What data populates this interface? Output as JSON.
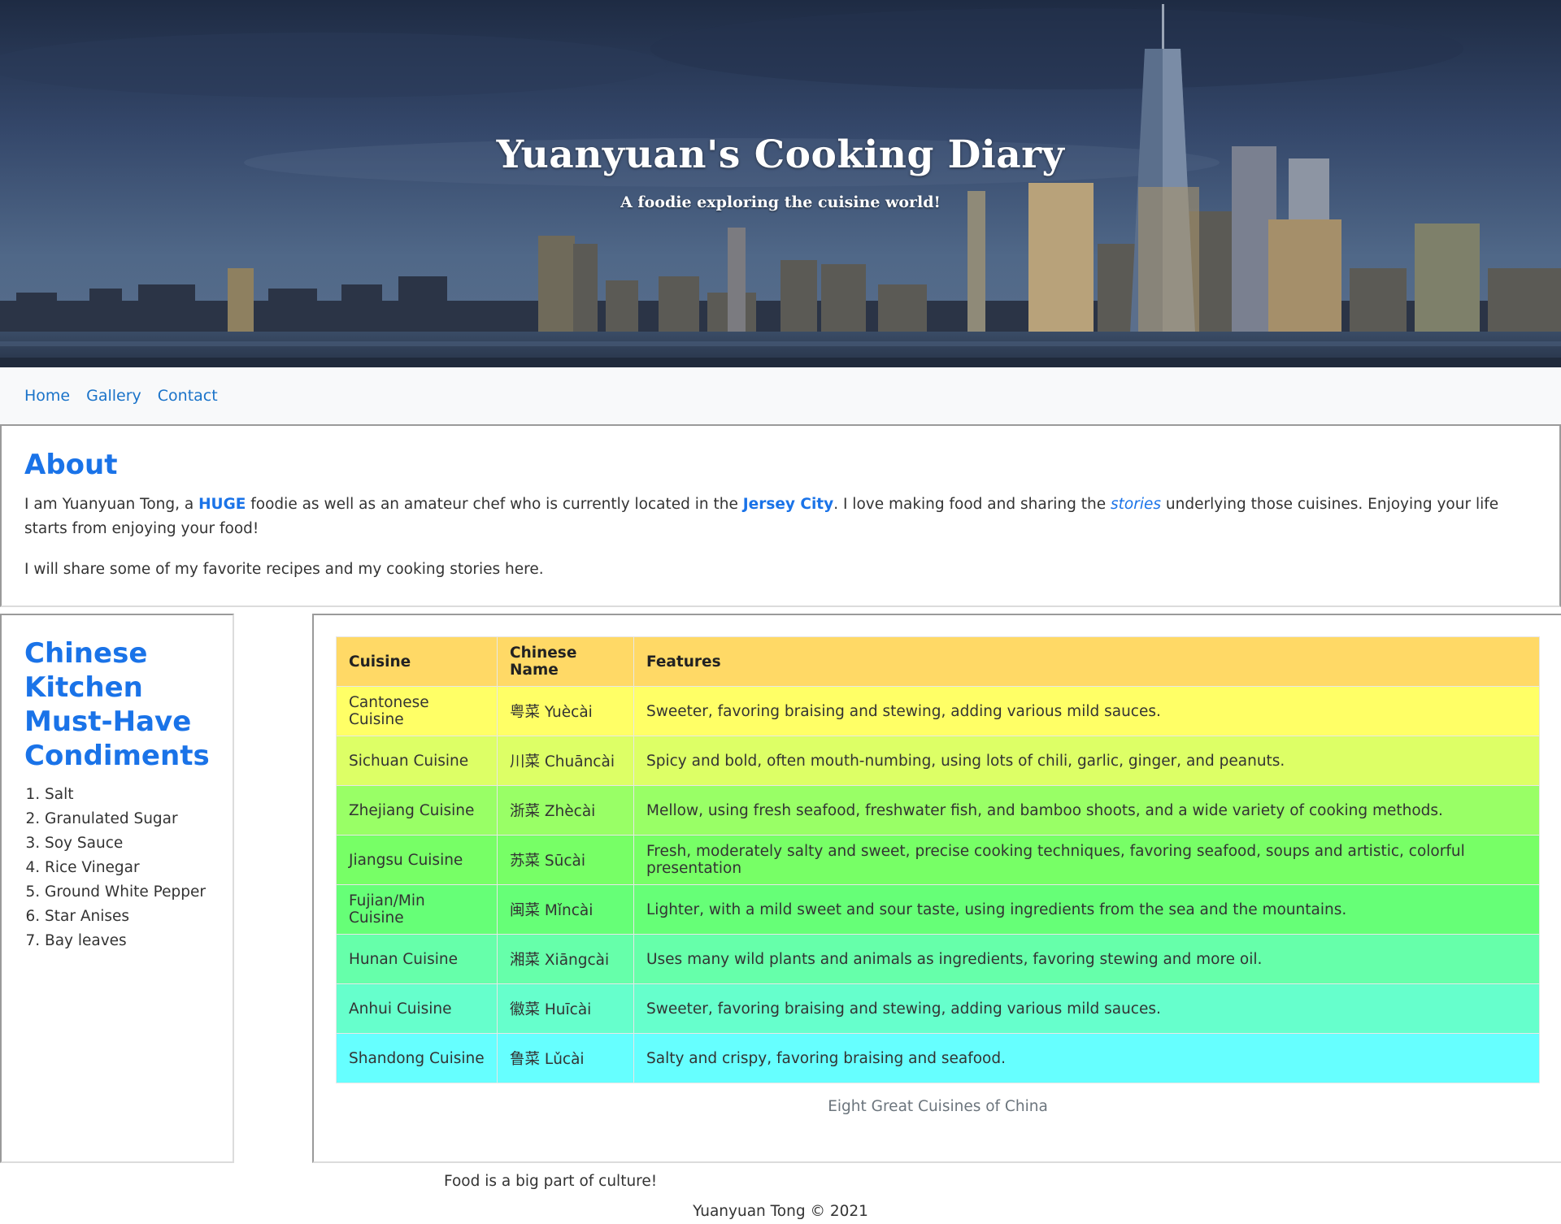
{
  "header": {
    "title": "Yuanyuan's Cooking Diary",
    "subtitle": "A foodie exploring the cuisine world!"
  },
  "nav": {
    "items": [
      {
        "label": "Home"
      },
      {
        "label": "Gallery"
      },
      {
        "label": "Contact"
      }
    ]
  },
  "about": {
    "heading": "About",
    "p1_a": "I am Yuanyuan Tong, a ",
    "p1_huge": "HUGE",
    "p1_b": " foodie as well as an amateur chef who is currently located in the ",
    "p1_city": "Jersey City",
    "p1_c": ". I love making food and sharing the ",
    "p1_stories": "stories",
    "p1_d": " underlying those cuisines. Enjoying your life starts from enjoying your food!",
    "p2": "I will share some of my favorite recipes and my cooking stories here."
  },
  "sidebar": {
    "heading": "Chinese Kitchen Must-Have Condiments",
    "items": [
      "Salt",
      "Granulated Sugar",
      "Soy Sauce",
      "Rice Vinegar",
      "Ground White Pepper",
      "Star Anises",
      "Bay leaves"
    ]
  },
  "table": {
    "headers": [
      "Cuisine",
      "Chinese Name",
      "Features"
    ],
    "rows": [
      {
        "cuisine": "Cantonese Cuisine",
        "chinese": "粤菜 Yuècài",
        "features": "Sweeter, favoring braising and stewing, adding various mild sauces.",
        "color": "#ffff66"
      },
      {
        "cuisine": "Sichuan Cuisine",
        "chinese": "川菜 Chuāncài",
        "features": "Spicy and bold, often mouth-numbing, using lots of chili, garlic, ginger, and peanuts.",
        "color": "#ddff66"
      },
      {
        "cuisine": "Zhejiang Cuisine",
        "chinese": "浙菜 Zhècài",
        "features": "Mellow, using fresh seafood, freshwater fish, and bamboo shoots, and a wide variety of cooking methods.",
        "color": "#99ff66"
      },
      {
        "cuisine": "Jiangsu Cuisine",
        "chinese": "苏菜 Sūcài",
        "features": "Fresh, moderately salty and sweet, precise cooking techniques, favoring seafood, soups and artistic, colorful presentation",
        "color": "#77ff66"
      },
      {
        "cuisine": "Fujian/Min Cuisine",
        "chinese": "闽菜 Mǐncài",
        "features": "Lighter, with a mild sweet and sour taste, using ingredients from the sea and the mountains.",
        "color": "#66ff77"
      },
      {
        "cuisine": "Hunan Cuisine",
        "chinese": "湘菜 Xiāngcài",
        "features": "Uses many wild plants and animals as ingredients, favoring stewing and more oil.",
        "color": "#66ffaa"
      },
      {
        "cuisine": "Anhui Cuisine",
        "chinese": "徽菜 Huīcài",
        "features": "Sweeter, favoring braising and stewing, adding various mild sauces.",
        "color": "#66ffcc"
      },
      {
        "cuisine": "Shandong Cuisine",
        "chinese": "鲁菜 Lǔcài",
        "features": "Salty and crispy, favoring braising and seafood.",
        "color": "#66ffff"
      }
    ],
    "header_color": "#ffd966",
    "caption": "Eight Great Cuisines of China"
  },
  "aside_note": "Food is a big part of culture!",
  "footer": "Yuanyuan Tong © 2021"
}
